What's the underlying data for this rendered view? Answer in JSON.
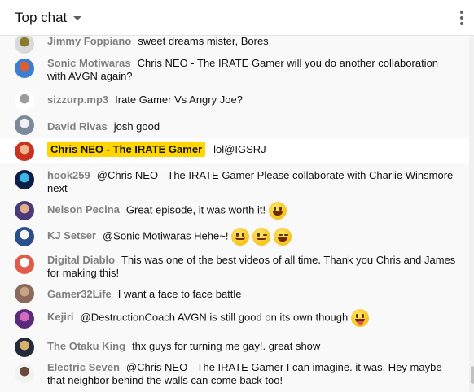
{
  "header": {
    "title": "Top chat"
  },
  "messages": [
    {
      "author": "Jimmy Foppiano",
      "text": "sweet dreams mister, Bores",
      "avatar_color": "#d9d9d9",
      "avatar_accent": "#8a7a2c"
    },
    {
      "author": "Sonic Motiwaras",
      "text": "Chris NEO - The IRATE Gamer will you do another collaboration with AVGN again?",
      "avatar_color": "#3b7fd1",
      "avatar_accent": "#e25b2a"
    },
    {
      "author": "sizzurp.mp3",
      "text": "Irate Gamer Vs Angry Joe?",
      "avatar_color": "#ffffff",
      "avatar_accent": "#9b9b9b"
    },
    {
      "author": "David Rivas",
      "text": "josh good",
      "avatar_color": "#7a8a99",
      "avatar_accent": "#f0f0f0"
    },
    {
      "author": "Chris NEO - The IRATE Gamer",
      "text": "lol@IGSRJ",
      "owner": true,
      "avatar_color": "#c8321e",
      "avatar_accent": "#f2b48a"
    },
    {
      "author": "hook259",
      "text": "@Chris NEO - The IRATE Gamer Please collaborate with Charlie Winsmore next",
      "avatar_color": "#0b1f46",
      "avatar_accent": "#3cb8e8"
    },
    {
      "author": "Nelson Pecina",
      "text": "Great episode, it was worth it!",
      "emojis": [
        "grin"
      ],
      "avatar_color": "#4a3a7a",
      "avatar_accent": "#e0b08a"
    },
    {
      "author": "KJ Setser",
      "text": "@Sonic Motiwaras Hehe~!",
      "emojis": [
        "smile",
        "wink",
        "laugh"
      ],
      "avatar_color": "#2b4f8a",
      "avatar_accent": "#f4f4f4"
    },
    {
      "author": "Digital Diablo",
      "text": "This was one of the best videos of all time. Thank you Chris and James for making this!",
      "avatar_color": "#e25a4a",
      "avatar_accent": "#ffffff"
    },
    {
      "author": "Gamer32Life",
      "text": "I want a face to face battle",
      "avatar_color": "#8a6a5a",
      "avatar_accent": "#c9a385"
    },
    {
      "author": "Kejiri",
      "text": "@DestructionCoach AVGN is still good on its own though",
      "emojis": [
        "tongue"
      ],
      "avatar_color": "#5b2a7a",
      "avatar_accent": "#d46ac0"
    },
    {
      "author": "The Otaku King",
      "text": "thx guys for turning me gay!. great show",
      "avatar_color": "#232a3a",
      "avatar_accent": "#d8b06a"
    },
    {
      "author": "Electric Seven",
      "text": "@Chris NEO - The IRATE Gamer I can imagine. it was. Hey maybe that neighbor behind the walls can come back too!",
      "avatar_color": "#f2f2f2",
      "avatar_accent": "#6a4a3a"
    }
  ]
}
